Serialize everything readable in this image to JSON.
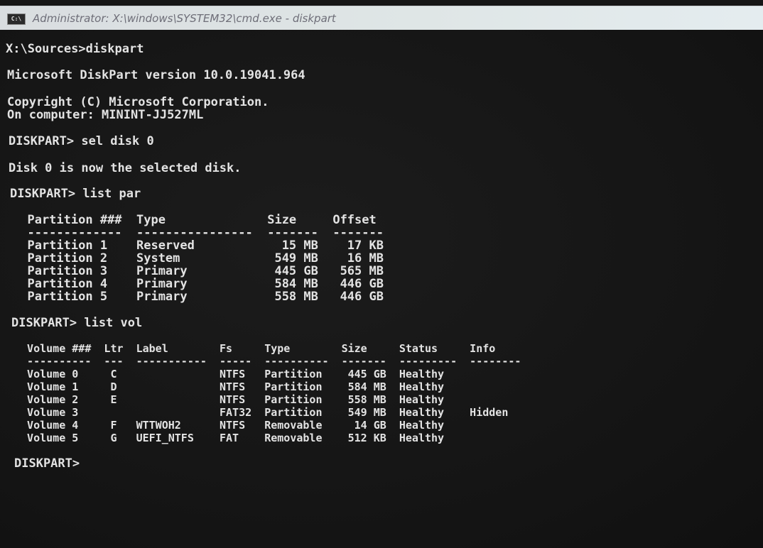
{
  "window": {
    "title": "Administrator: X:\\windows\\SYSTEM32\\cmd.exe - diskpart",
    "icon": "cmd-icon",
    "icon_text": "C:\\"
  },
  "console": {
    "lines": [
      "X:\\Sources>diskpart",
      "Microsoft DiskPart version 10.0.19041.964",
      "Copyright (C) Microsoft Corporation.",
      "On computer: MININT-JJ527ML",
      "DISKPART> sel disk 0",
      "Disk 0 is now the selected disk.",
      "DISKPART> list par",
      "  Partition ###  Type              Size     Offset",
      "  -------------  ----------------  -------  -------",
      "  Partition 1    Reserved            15 MB    17 KB",
      "  Partition 2    System             549 MB    16 MB",
      "  Partition 3    Primary            445 GB   565 MB",
      "  Partition 4    Primary            584 MB   446 GB",
      "  Partition 5    Primary            558 MB   446 GB",
      "DISKPART> list vol",
      "  Volume ###  Ltr  Label        Fs     Type        Size     Status     Info",
      "  ----------  ---  -----------  -----  ----------  -------  ---------  --------",
      "  Volume 0     C                NTFS   Partition    445 GB  Healthy",
      "  Volume 1     D                NTFS   Partition    584 MB  Healthy",
      "  Volume 2     E                NTFS   Partition    558 MB  Healthy",
      "  Volume 3                      FAT32  Partition    549 MB  Healthy    Hidden",
      "  Volume 4     F   WTTWOH2      NTFS   Removable     14 GB  Healthy",
      "  Volume 5     G   UEFI_NTFS    FAT    Removable    512 KB  Healthy",
      "DISKPART>"
    ]
  },
  "colors": {
    "console_background": "#161616",
    "console_text": "#e3e3e3",
    "titlebar": "#dfe6e6",
    "title_text": "#6e6e78"
  }
}
